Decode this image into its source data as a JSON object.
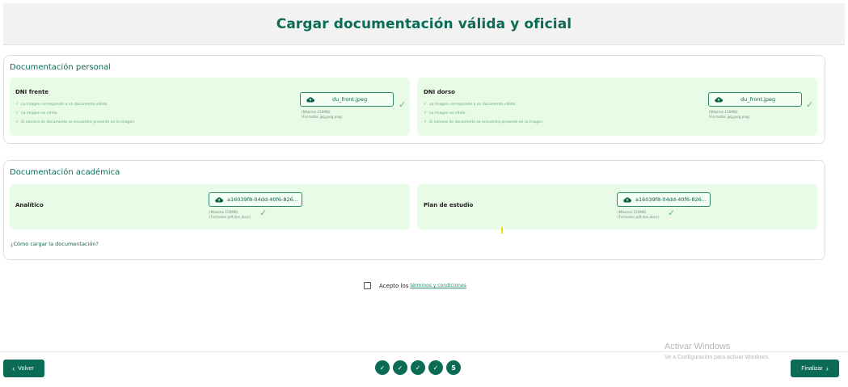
{
  "header": {
    "title": "Cargar documentación válida y oficial"
  },
  "personal": {
    "title": "Documentación personal",
    "cards": [
      {
        "title": "DNI frente",
        "rules": [
          "La imagen corresponde a un documento válido.",
          "La imagen es nítida.",
          "El número de documento se encuentra presente en la imagen."
        ],
        "file": "du_front.jpeg",
        "hint1": "(Máximo 150MB)",
        "hint2": "(Formatos jpg,jpeg,png)"
      },
      {
        "title": "DNI dorso",
        "rules": [
          "La imagen corresponde a un documento válido.",
          "La imagen es nítida.",
          "El número de documento se encuentra presente en la imagen."
        ],
        "file": "du_front.jpeg",
        "hint1": "(Máximo 150MB)",
        "hint2": "(Formatos jpg,jpeg,png)"
      }
    ]
  },
  "academic": {
    "title": "Documentación académica",
    "cards": [
      {
        "title": "Analítico",
        "file": "a16039f8-04dd-40f6-826...",
        "hint1": "(Máximo 150MB)",
        "hint2": "(Formatos pdf,doc,docx)"
      },
      {
        "title": "Plan de estudio",
        "file": "a16039f8-04dd-40f6-826...",
        "hint1": "(Máximo 150MB)",
        "hint2": "(Formatos pdf,doc,docx)"
      }
    ],
    "help_link": "¿Cómo cargar la documentación?"
  },
  "terms": {
    "prefix": "Acepto los",
    "link": "términos y condiciones",
    "checked": false
  },
  "footer": {
    "back_label": "Volver",
    "next_label": "Finalizar",
    "steps": [
      "✓",
      "✓",
      "✓",
      "✓",
      "5"
    ]
  },
  "watermark": {
    "title": "Activar Windows",
    "subtitle": "Ve a Configuración para activar Windows."
  },
  "colors": {
    "brand": "#0b6b55",
    "card_bg": "#e8fbe6",
    "check": "#5cba82"
  }
}
